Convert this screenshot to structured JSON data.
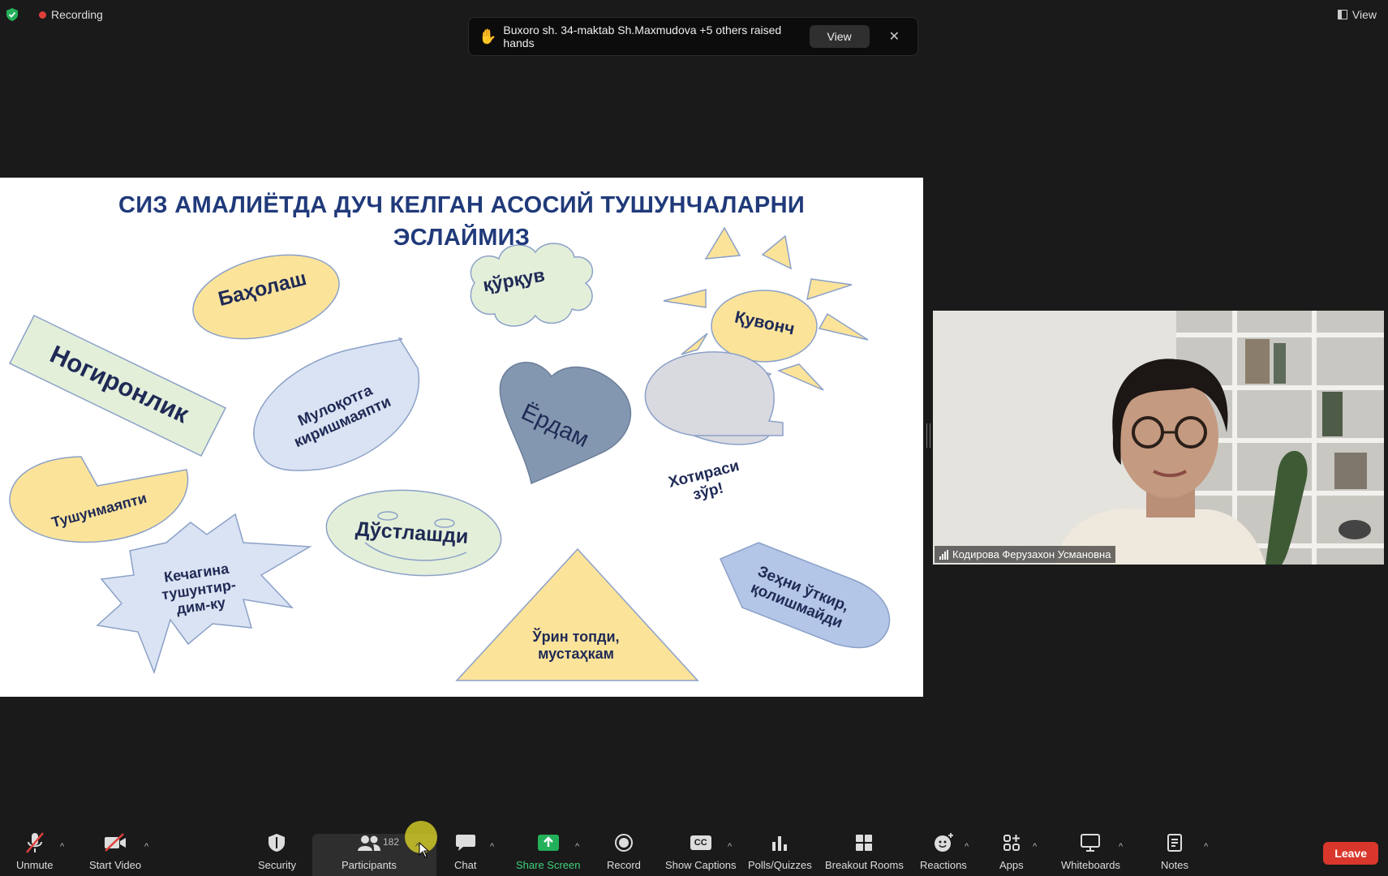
{
  "top": {
    "recording_label": "Recording",
    "view_label": "View"
  },
  "notification": {
    "message": "Buxoro sh. 34-maktab Sh.Maxmudova +5 others raised hands",
    "view_button": "View",
    "close_symbol": "✕"
  },
  "slide": {
    "title_line1": "СИЗ АМАЛИЁТДА ДУЧ КЕЛГАН АСОСИЙ ТУШУНЧАЛАРНИ",
    "title_line2": "ЭСЛАЙМИЗ",
    "words": {
      "baholash": "Баҳолаш",
      "qurquv": "қўрқув",
      "quvonch": "Қувонч",
      "nogironlik": "Ногиронлик",
      "muloqot": "Мулоқотга киришмаяпти",
      "yordam": "Ёрдам",
      "xotirasi": "Хотираси зўр!",
      "tushunmayapti": "Тушунмаяпти",
      "dustlashdi": "Дўстлашди",
      "kechagina": "Кечагина тушунтир-дим-ку",
      "urin": "Ўрин топди, мустаҳкам",
      "zehni": "Зеҳни ўткир, қолишмайди"
    },
    "colors": {
      "yellow": "#fbe39a",
      "green": "#e3efd9",
      "blue_light": "#dae3f3",
      "blue_dark": "#8497b0",
      "gray": "#d9d9e0",
      "blue_mid": "#b4c6e7",
      "title": "#203a7a"
    }
  },
  "video": {
    "name": "Кодирова Ферузахон Усмановна"
  },
  "toolbar": {
    "unmute": "Unmute",
    "start_video": "Start Video",
    "security": "Security",
    "participants": "Participants",
    "participants_count": "182",
    "chat": "Chat",
    "share_screen": "Share Screen",
    "record": "Record",
    "show_captions": "Show Captions",
    "captions_glyph": "CC",
    "polls": "Polls/Quizzes",
    "breakout": "Breakout Rooms",
    "reactions": "Reactions",
    "apps": "Apps",
    "whiteboards": "Whiteboards",
    "notes": "Notes",
    "leave": "Leave"
  }
}
